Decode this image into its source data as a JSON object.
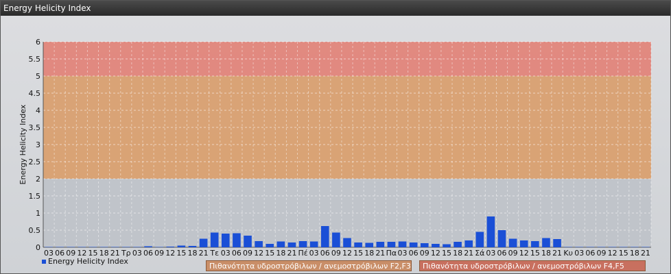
{
  "window": {
    "title": "Energy Helicity Index"
  },
  "colors": {
    "bar": "#1a4fd6",
    "zone_low": "#bfc3c9",
    "zone_f2f3": "#d9a070",
    "zone_f4f5": "#e2857a",
    "legend_f2f3_bg": "#c98e68",
    "legend_f4f5_bg": "#c8705f"
  },
  "legend": {
    "series_label": "Energy Helicity Index",
    "zone_f2f3_label": "Πιθανότητα υδροστρόβιλων / ανεμοστρόβιλων F2,F3",
    "zone_f4f5_label": "Πιθανότητα υδροστρόβιλων / ανεμοστρόβιλων F4,F5"
  },
  "chart_data": {
    "type": "bar",
    "title": "",
    "xlabel": "",
    "ylabel": "Energy Helicity Index",
    "ylim": [
      0,
      6
    ],
    "yticks": [
      "0",
      "0.5",
      "1",
      "1.5",
      "2",
      "2.5",
      "3",
      "3.5",
      "4",
      "4.5",
      "5",
      "5.5",
      "6"
    ],
    "grid": true,
    "bands": [
      {
        "from": 0,
        "to": 2,
        "color_key": "zone_low"
      },
      {
        "from": 2,
        "to": 5,
        "color_key": "zone_f2f3"
      },
      {
        "from": 5,
        "to": 6,
        "color_key": "zone_f4f5"
      }
    ],
    "categories": [
      "03",
      "06",
      "09",
      "12",
      "15",
      "18",
      "21",
      "Τρ",
      "03",
      "06",
      "09",
      "12",
      "15",
      "18",
      "21",
      "Τε",
      "03",
      "06",
      "09",
      "12",
      "15",
      "18",
      "21",
      "Πέ",
      "03",
      "06",
      "09",
      "12",
      "15",
      "18",
      "21",
      "Πα",
      "03",
      "06",
      "09",
      "12",
      "15",
      "18",
      "21",
      "Σά",
      "03",
      "06",
      "09",
      "12",
      "15",
      "18",
      "21",
      "Κυ",
      "03",
      "06",
      "09",
      "12",
      "15",
      "18",
      "21"
    ],
    "series": [
      {
        "name": "Energy Helicity Index",
        "values": [
          0.01,
          0.01,
          0.01,
          0.01,
          0.01,
          0.01,
          0.01,
          0.01,
          0.01,
          0.03,
          0.01,
          0.02,
          0.05,
          0.04,
          0.25,
          0.43,
          0.4,
          0.41,
          0.34,
          0.18,
          0.1,
          0.17,
          0.14,
          0.18,
          0.17,
          0.62,
          0.43,
          0.27,
          0.14,
          0.13,
          0.16,
          0.16,
          0.17,
          0.14,
          0.12,
          0.1,
          0.09,
          0.16,
          0.2,
          0.45,
          0.9,
          0.5,
          0.25,
          0.2,
          0.18,
          0.27,
          0.24,
          0.01,
          0.01,
          0.01,
          0.01,
          0.01,
          0.01,
          0.01,
          0.01
        ]
      }
    ]
  }
}
